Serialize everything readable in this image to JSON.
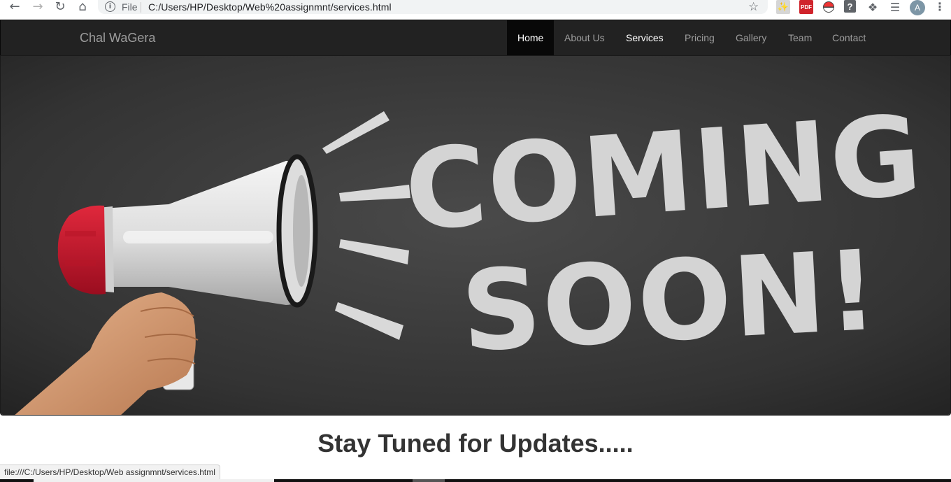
{
  "browser": {
    "file_label": "File",
    "url": "C:/Users/HP/Desktop/Web%20assignmnt/services.html",
    "avatar_letter": "A",
    "pdf_badge": "PDF",
    "help_badge": "?"
  },
  "navbar": {
    "brand": "Chal WaGera",
    "items": [
      {
        "label": "Home",
        "state": "active"
      },
      {
        "label": "About Us",
        "state": "normal"
      },
      {
        "label": "Services",
        "state": "hover"
      },
      {
        "label": "Pricing",
        "state": "normal"
      },
      {
        "label": "Gallery",
        "state": "normal"
      },
      {
        "label": "Team",
        "state": "normal"
      },
      {
        "label": "Contact",
        "state": "normal"
      }
    ],
    "colors": {
      "bar": "#222222",
      "active_bg": "#080808",
      "text": "#9d9d9d",
      "active_text": "#ffffff"
    }
  },
  "hero": {
    "line1": "COMING",
    "line2": "SOON!",
    "image_subject": "megaphone-in-hand-on-chalkboard"
  },
  "tagline": "Stay Tuned for Updates.....",
  "status_bar": {
    "link_preview": "file:///C:/Users/HP/Desktop/Web assignmnt/services.html"
  }
}
